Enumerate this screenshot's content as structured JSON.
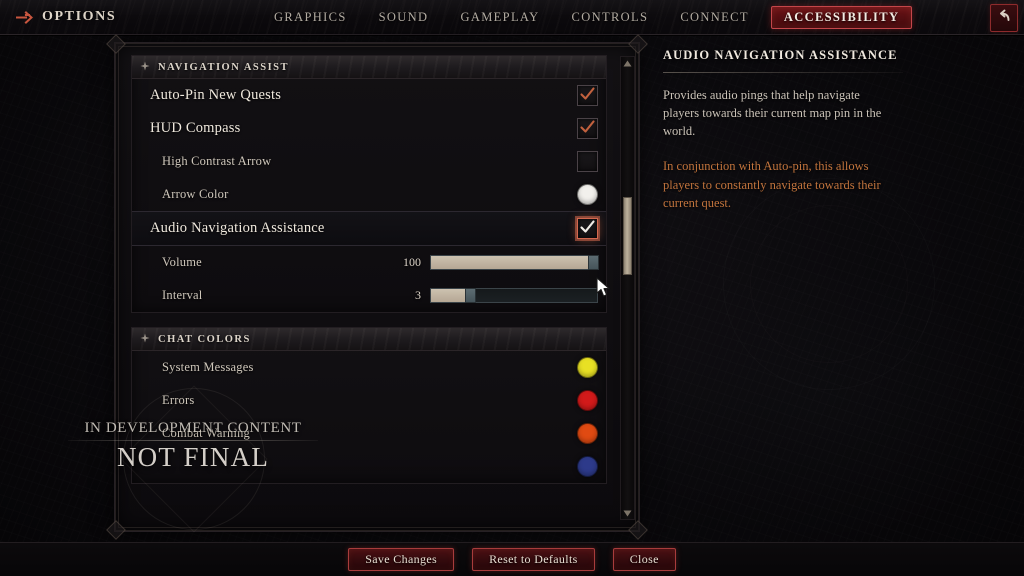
{
  "topbar": {
    "options_label": "OPTIONS",
    "options_icon": "arrow-right-icon",
    "back_icon": "back-arrow-icon",
    "tabs": [
      {
        "label": "GRAPHICS",
        "active": false
      },
      {
        "label": "SOUND",
        "active": false
      },
      {
        "label": "GAMEPLAY",
        "active": false
      },
      {
        "label": "CONTROLS",
        "active": false
      },
      {
        "label": "CONNECT",
        "active": false
      },
      {
        "label": "ACCESSIBILITY",
        "active": true
      }
    ]
  },
  "sections": [
    {
      "title": "NAVIGATION ASSIST",
      "icon": "diamond-icon",
      "rows": [
        {
          "label": "Auto-Pin New Quests",
          "control": "checkbox",
          "checked": true,
          "indent": false
        },
        {
          "label": "HUD Compass",
          "control": "checkbox",
          "checked": true,
          "indent": false
        },
        {
          "label": "High Contrast Arrow",
          "control": "checkbox",
          "checked": false,
          "indent": true
        },
        {
          "label": "Arrow Color",
          "control": "color",
          "color": "#f2f0ec",
          "indent": true
        },
        {
          "label": "Audio Navigation Assistance",
          "control": "checkbox",
          "checked": true,
          "indent": false,
          "focused": true
        },
        {
          "label": "Volume",
          "control": "slider",
          "value": "100",
          "percent": 100,
          "indent": true
        },
        {
          "label": "Interval",
          "control": "slider",
          "value": "3",
          "percent": 22,
          "indent": true
        }
      ]
    },
    {
      "title": "CHAT COLORS",
      "icon": "diamond-icon",
      "rows": [
        {
          "label": "System Messages",
          "control": "color",
          "color": "#e8e024",
          "indent": true
        },
        {
          "label": "Errors",
          "control": "color",
          "color": "#d21a1a",
          "indent": true
        },
        {
          "label": "Combat Warning",
          "control": "color",
          "color": "#e04a12",
          "indent": true
        },
        {
          "label": "",
          "control": "color",
          "color": "#2d3a8a",
          "indent": true
        }
      ]
    }
  ],
  "scrollbar": {
    "up_icon": "triangle-up-icon",
    "down_icon": "triangle-down-icon",
    "thumb_name": "scrollbar-thumb"
  },
  "description": {
    "title": "AUDIO NAVIGATION ASSISTANCE",
    "body": "Provides audio pings that help navigate players towards their current map pin in the world.",
    "note": "In conjunction with Auto-pin, this allows players to constantly navigate towards their current quest."
  },
  "watermark": {
    "line1": "IN DEVELOPMENT CONTENT",
    "line2": "NOT FINAL"
  },
  "footer": {
    "buttons": [
      {
        "label": "Save Changes"
      },
      {
        "label": "Reset to Defaults"
      },
      {
        "label": "Close"
      }
    ]
  },
  "colors": {
    "accent_red": "#a83c3c",
    "tab_active_bg": "#5a0f12",
    "note_orange": "#c2743d",
    "check_orange": "#c2613e",
    "slider_fill": "#c3b7a5",
    "scrollbar_thumb": "#bdb19c"
  }
}
